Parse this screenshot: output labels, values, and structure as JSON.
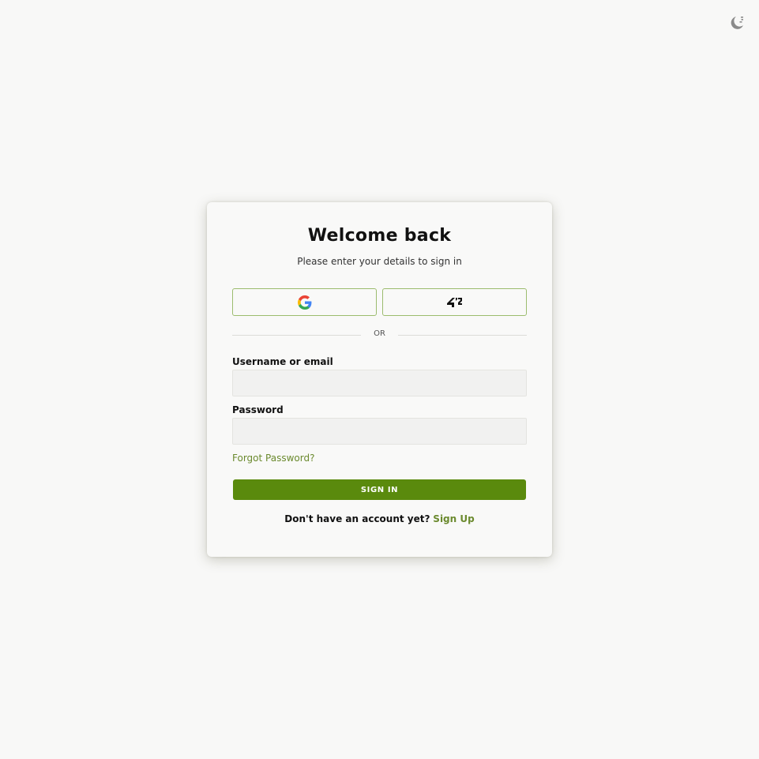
{
  "header": {
    "theme_toggle_icon": "moon-stars-icon"
  },
  "login": {
    "title": "Welcome back",
    "subtitle": "Please enter your details to sign in",
    "oauth": [
      {
        "provider": "google",
        "icon": "google-icon"
      },
      {
        "provider": "42",
        "icon": "42-logo-icon"
      }
    ],
    "divider_text": "OR",
    "username_label": "Username or email",
    "username_value": "",
    "password_label": "Password",
    "password_value": "",
    "forgot_password": "Forgot Password?",
    "signin_button": "SIGN IN",
    "signup_prompt": "Don't have an account yet?",
    "signup_link": "Sign Up"
  },
  "colors": {
    "background": "#f8f8f7",
    "card": "#f9f9f8",
    "accent": "#5a8a0d",
    "link": "#6b8a2e",
    "oauth_border": "#9cbc6e"
  }
}
